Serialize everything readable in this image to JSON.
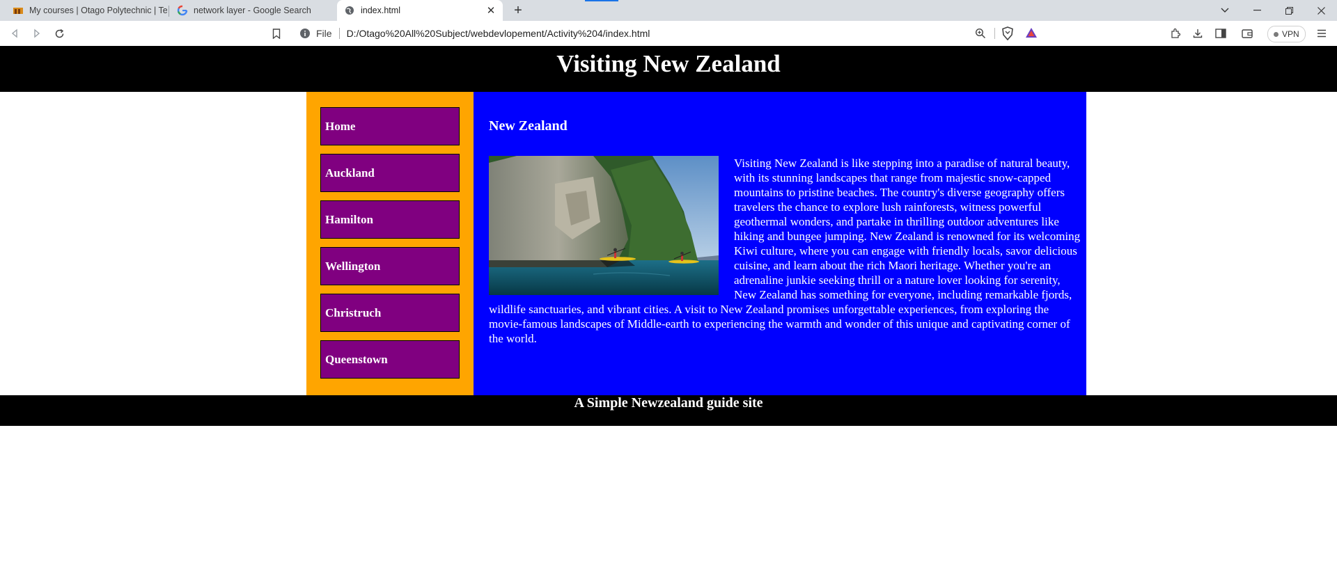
{
  "browser": {
    "tabs": [
      {
        "title": "My courses | Otago Polytechnic | Te P",
        "icon": "otago-favicon-icon"
      },
      {
        "title": "network layer - Google Search",
        "icon": "google-icon"
      },
      {
        "title": "index.html",
        "icon": "globe-icon",
        "active": true
      }
    ],
    "address": {
      "scheme_label": "File",
      "url": "D:/Otago%20All%20Subject/webdevlopement/Activity%204/index.html"
    },
    "vpn_label": "VPN"
  },
  "site": {
    "title": "Visiting New Zealand",
    "nav": [
      "Home",
      "Auckland",
      "Hamilton",
      "Wellington",
      "Christruch",
      "Queenstown"
    ],
    "section_heading": "New Zealand",
    "article": "Visiting New Zealand is like stepping into a paradise of natural beauty, with its stunning landscapes that range from majestic snow-capped mountains to pristine beaches. The country's diverse geography offers travelers the chance to explore lush rainforests, witness powerful geothermal wonders, and partake in thrilling outdoor adventures like hiking and bungee jumping. New Zealand is renowned for its welcoming Kiwi culture, where you can engage with friendly locals, savor delicious cuisine, and learn about the rich Maori heritage. Whether you're an adrenaline junkie seeking thrill or a nature lover looking for serenity, New Zealand has something for everyone, including remarkable fjords, wildlife sanctuaries, and vibrant cities. A visit to New Zealand promises unforgettable experiences, from exploring the movie-famous landscapes of Middle-earth to experiencing the warmth and wonder of this unique and captivating corner of the world.",
    "footer": "A Simple Newzealand guide site"
  },
  "colors": {
    "header_bg": "#000000",
    "sidebar_bg": "#ffa500",
    "nav_bg": "#800080",
    "main_bg": "#0000ff",
    "text": "#ffffff"
  }
}
